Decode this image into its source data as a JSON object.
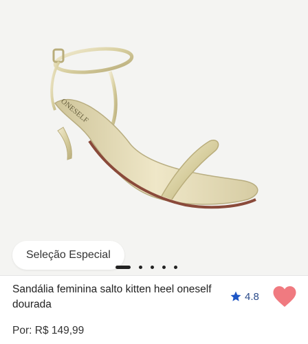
{
  "product": {
    "image_alt": "ONESELF",
    "badge": "Seleção Especial",
    "carousel": {
      "count": 5,
      "active": 0
    },
    "title": "Sandália feminina salto kitten heel oneself dourada",
    "rating": "4.8",
    "price_prefix": "Por:",
    "price": "R$ 149,99"
  },
  "icons": {
    "star": "star-icon",
    "heart": "heart-icon"
  },
  "colors": {
    "rating_blue": "#1e56c6",
    "heart_pink": "#f07a80",
    "gold": "#d8cfa0"
  }
}
